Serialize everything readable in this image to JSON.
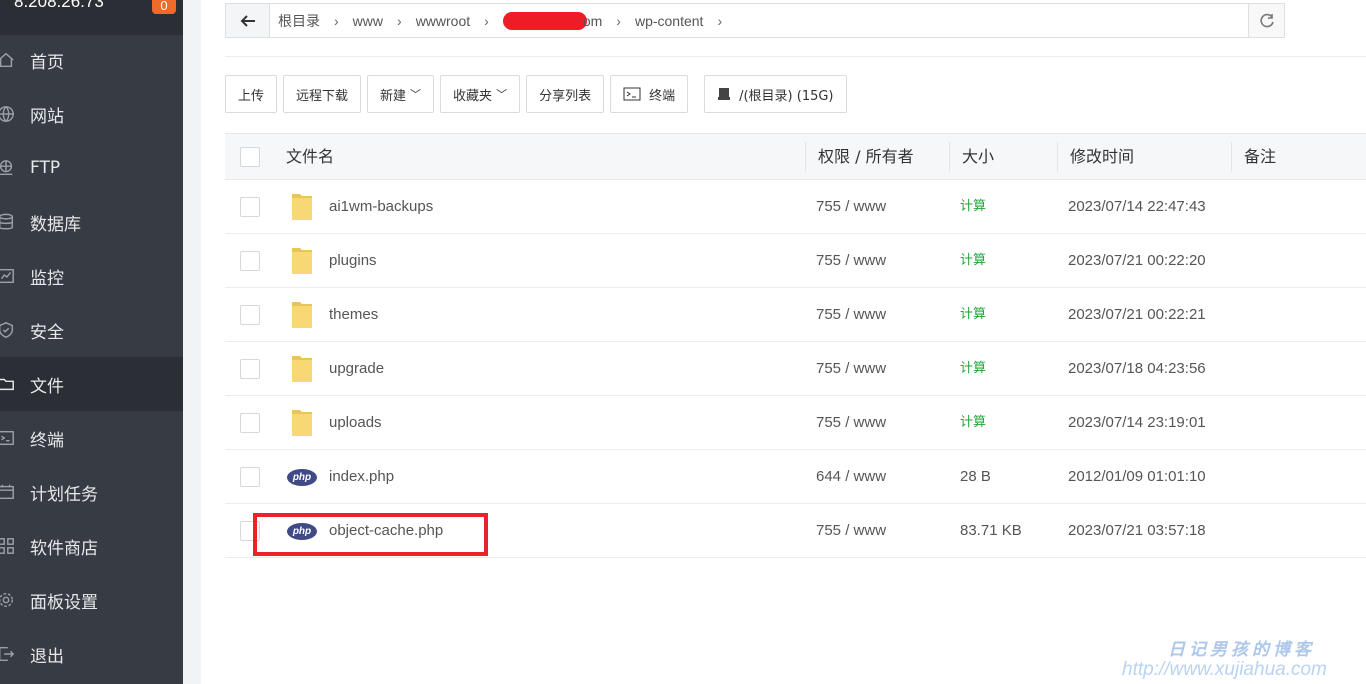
{
  "sidebar": {
    "server_ip": "8.208.26.73",
    "badge": "0",
    "items": [
      {
        "label": "首页",
        "icon": "home-icon"
      },
      {
        "label": "网站",
        "icon": "globe-icon"
      },
      {
        "label": "FTP",
        "icon": "ftp-icon"
      },
      {
        "label": "数据库",
        "icon": "database-icon"
      },
      {
        "label": "监控",
        "icon": "monitor-icon"
      },
      {
        "label": "安全",
        "icon": "shield-icon"
      },
      {
        "label": "文件",
        "icon": "folder-icon"
      },
      {
        "label": "终端",
        "icon": "terminal-icon"
      },
      {
        "label": "计划任务",
        "icon": "calendar-icon"
      },
      {
        "label": "软件商店",
        "icon": "apps-icon"
      },
      {
        "label": "面板设置",
        "icon": "gear-icon"
      },
      {
        "label": "退出",
        "icon": "logout-icon"
      }
    ],
    "active_index": 6
  },
  "path": {
    "crumbs": [
      "根目录",
      "www",
      "wwwroot",
      "om",
      "wp-content"
    ]
  },
  "toolbar": {
    "upload": "上传",
    "remote_download": "远程下载",
    "new": "新建",
    "favorites": "收藏夹",
    "share_list": "分享列表",
    "terminal": "终端",
    "disk": "/(根目录) (15G)"
  },
  "table": {
    "headers": {
      "name": "文件名",
      "perm": "权限 / 所有者",
      "size": "大小",
      "mtime": "修改时间",
      "note": "备注"
    },
    "rows": [
      {
        "type": "folder",
        "name": "ai1wm-backups",
        "perm": "755 / www",
        "size": "计算",
        "mtime": "2023/07/14 22:47:43"
      },
      {
        "type": "folder",
        "name": "plugins",
        "perm": "755 / www",
        "size": "计算",
        "mtime": "2023/07/21 00:22:20"
      },
      {
        "type": "folder",
        "name": "themes",
        "perm": "755 / www",
        "size": "计算",
        "mtime": "2023/07/21 00:22:21"
      },
      {
        "type": "folder",
        "name": "upgrade",
        "perm": "755 / www",
        "size": "计算",
        "mtime": "2023/07/18 04:23:56"
      },
      {
        "type": "folder",
        "name": "uploads",
        "perm": "755 / www",
        "size": "计算",
        "mtime": "2023/07/14 23:19:01"
      },
      {
        "type": "php",
        "name": "index.php",
        "perm": "644 / www",
        "size": "28 B",
        "mtime": "2012/01/09 01:01:10"
      },
      {
        "type": "php",
        "name": "object-cache.php",
        "perm": "755 / www",
        "size": "83.71 KB",
        "mtime": "2023/07/21 03:57:18"
      }
    ],
    "php_label": "php"
  },
  "watermark": {
    "line1": "日记男孩的博客",
    "line2": "http://www.xujiahua.com"
  },
  "colors": {
    "sidebar_bg": "#373c44",
    "accent_green": "#20a53a",
    "highlight_red": "#e8232a",
    "badge_orange": "#ee6b2c"
  }
}
